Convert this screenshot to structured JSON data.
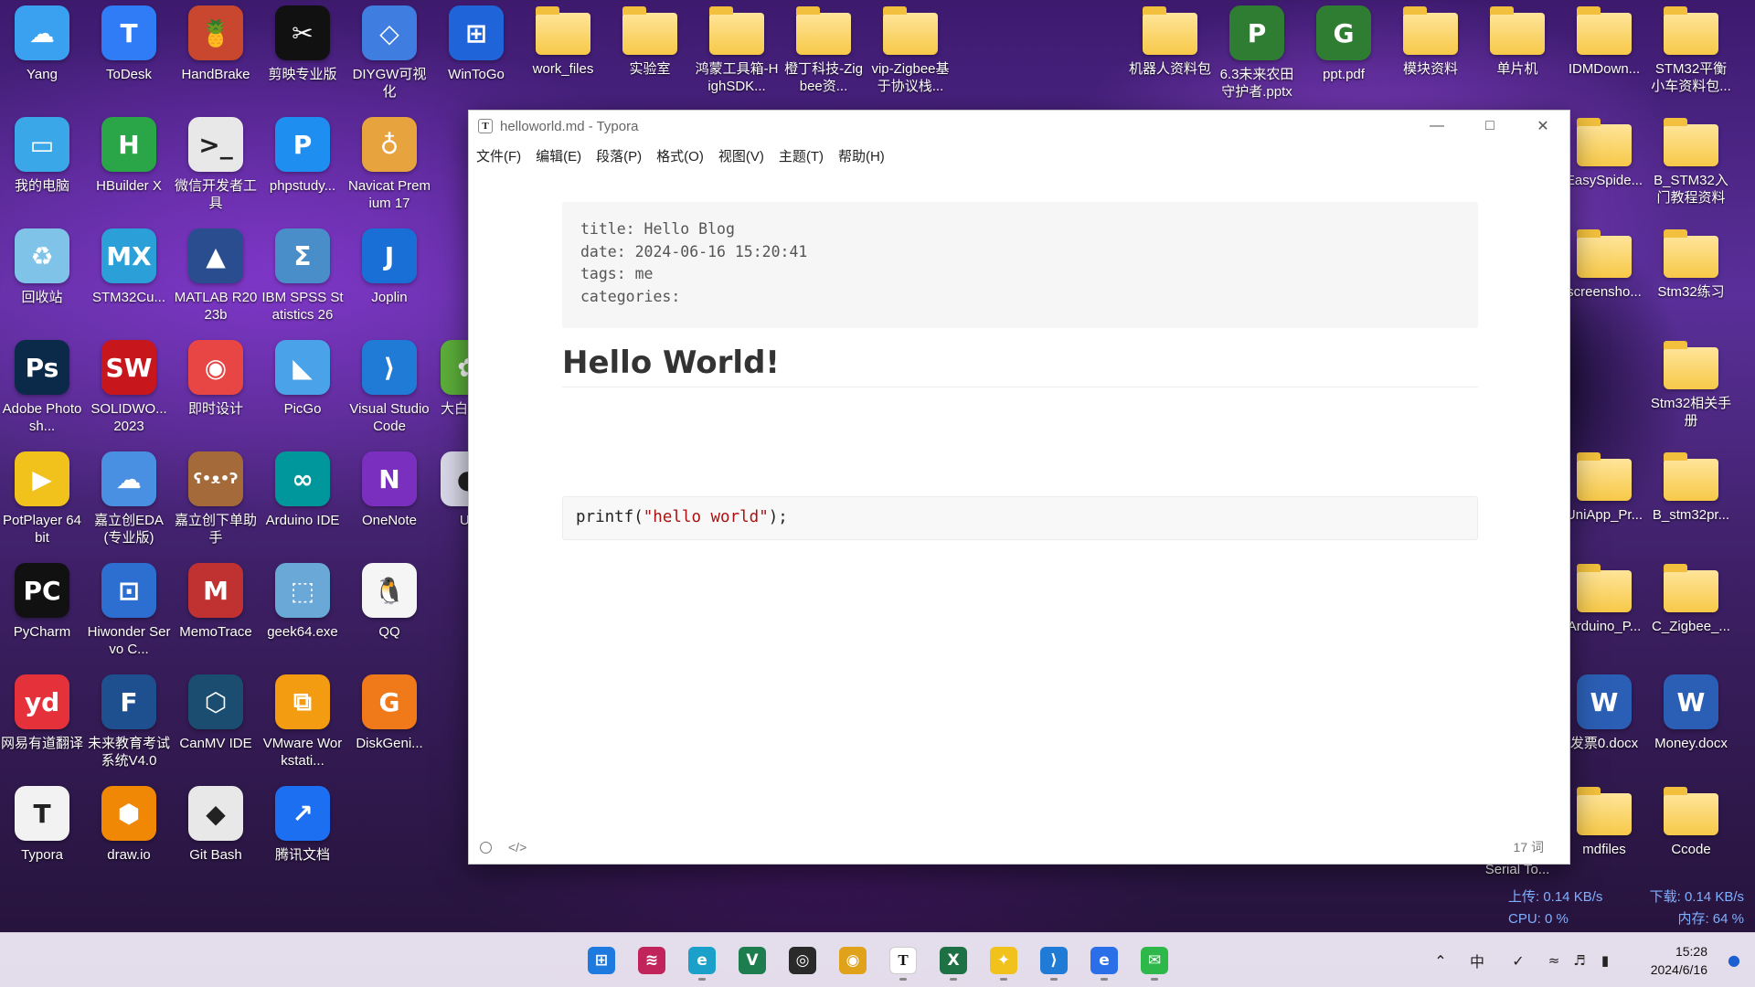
{
  "desktop_icons": [
    {
      "label": "Yang",
      "icon": "cloud-icon",
      "bg": "#3aa0f0"
    },
    {
      "label": "ToDesk",
      "icon": "todesk-icon",
      "bg": "#2f7cf6"
    },
    {
      "label": "HandBrake",
      "icon": "handbrake-icon",
      "bg": "#c9472f"
    },
    {
      "label": "剪映专业版",
      "icon": "capcut-icon",
      "bg": "#111111"
    },
    {
      "label": "DIYGW可视化",
      "icon": "diygw-icon",
      "bg": "#3f7de0"
    },
    {
      "label": "WinToGo",
      "icon": "wintogo-icon",
      "bg": "#1f64d8"
    },
    {
      "label": "work_files",
      "icon": "folder-icon",
      "bg": "folder"
    },
    {
      "label": "实验室",
      "icon": "folder-icon",
      "bg": "folder"
    },
    {
      "label": "鸿蒙工具箱-HighSDK...",
      "icon": "folder-icon",
      "bg": "folder"
    },
    {
      "label": "橙丁科技-Zigbee资...",
      "icon": "folder-icon",
      "bg": "folder"
    },
    {
      "label": "vip-Zigbee基于协议栈...",
      "icon": "folder-icon",
      "bg": "folder"
    },
    {
      "label": "机器人资料包",
      "icon": "folder-icon",
      "bg": "folder"
    },
    {
      "label": "6.3未来农田守护者.pptx",
      "icon": "pptx-icon",
      "bg": "#2e7d32"
    },
    {
      "label": "ppt.pdf",
      "icon": "pdf-icon",
      "bg": "#2e7d32"
    },
    {
      "label": "模块资料",
      "icon": "folder-icon",
      "bg": "folder"
    },
    {
      "label": "单片机",
      "icon": "folder-icon",
      "bg": "folder"
    },
    {
      "label": "IDMDown...",
      "icon": "folder-icon",
      "bg": "folder"
    },
    {
      "label": "STM32平衡小车资料包...",
      "icon": "folder-icon",
      "bg": "folder"
    },
    {
      "label": "我的电脑",
      "icon": "computer-icon",
      "bg": "#39a7e8"
    },
    {
      "label": "HBuilder X",
      "icon": "hbuilder-icon",
      "bg": "#2aa548"
    },
    {
      "label": "微信开发者工具",
      "icon": "wechat-devtools-icon",
      "bg": "#e8e8e8"
    },
    {
      "label": "phpstudy...",
      "icon": "phpstudy-icon",
      "bg": "#1f8ef1"
    },
    {
      "label": "Navicat Premium 17",
      "icon": "navicat-icon",
      "bg": "#e7a33d"
    },
    {
      "label": "EasySpide...",
      "icon": "folder-icon",
      "bg": "folder"
    },
    {
      "label": "B_STM32入门教程资料",
      "icon": "folder-icon",
      "bg": "folder"
    },
    {
      "label": "回收站",
      "icon": "recycle-bin-icon",
      "bg": "#7fc4e8"
    },
    {
      "label": "STM32Cu...",
      "icon": "stm32cube-icon",
      "bg": "#2a9fd8"
    },
    {
      "label": "MATLAB R2023b",
      "icon": "matlab-icon",
      "bg": "#2a4d8f"
    },
    {
      "label": "IBM SPSS Statistics 26",
      "icon": "spss-icon",
      "bg": "#4a8ec9"
    },
    {
      "label": "Joplin",
      "icon": "joplin-icon",
      "bg": "#1a6fd6"
    },
    {
      "label": "screensho...",
      "icon": "folder-icon",
      "bg": "folder"
    },
    {
      "label": "Stm32练习",
      "icon": "folder-icon",
      "bg": "folder"
    },
    {
      "label": "Adobe Photosh...",
      "icon": "photoshop-icon",
      "bg": "#0b2a4a"
    },
    {
      "label": "SOLIDWO... 2023",
      "icon": "solidworks-icon",
      "bg": "#c8161d"
    },
    {
      "label": "即时设计",
      "icon": "jsdesign-icon",
      "bg": "#e84545"
    },
    {
      "label": "PicGo",
      "icon": "picgo-icon",
      "bg": "#4aa3e8"
    },
    {
      "label": "Visual Studio Code",
      "icon": "vscode-icon",
      "bg": "#1f7bd6"
    },
    {
      "label": "大白菜装",
      "icon": "dabaicai-icon",
      "bg": "#5cae3a"
    },
    {
      "label": "Stm32相关手册",
      "icon": "folder-icon",
      "bg": "folder"
    },
    {
      "label": "PotPlayer 64 bit",
      "icon": "potplayer-icon",
      "bg": "#f1c21b"
    },
    {
      "label": "嘉立创EDA(专业版)",
      "icon": "jlc-eda-icon",
      "bg": "#4a90e2"
    },
    {
      "label": "嘉立创下单助手",
      "icon": "jlc-bear-icon",
      "bg": "#a56a3a"
    },
    {
      "label": "Arduino IDE",
      "icon": "arduino-icon",
      "bg": "#00979c"
    },
    {
      "label": "OneNote",
      "icon": "onenote-icon",
      "bg": "#7b2fbe"
    },
    {
      "label": "Ult",
      "icon": "ult-icon",
      "bg": "#d8d8e8"
    },
    {
      "label": "UniApp_Pr...",
      "icon": "folder-icon",
      "bg": "folder"
    },
    {
      "label": "B_stm32pr...",
      "icon": "folder-icon",
      "bg": "folder"
    },
    {
      "label": "PyCharm",
      "icon": "pycharm-icon",
      "bg": "#111111"
    },
    {
      "label": "Hiwonder Servo C...",
      "icon": "hiwonder-icon",
      "bg": "#2d6fd1"
    },
    {
      "label": "MemoTrace",
      "icon": "memotrace-icon",
      "bg": "#c03232"
    },
    {
      "label": "geek64.exe",
      "icon": "geek-icon",
      "bg": "#6aa8d8"
    },
    {
      "label": "QQ",
      "icon": "qq-icon",
      "bg": "#f5f5f5"
    },
    {
      "label": "Arduino_P...",
      "icon": "folder-icon",
      "bg": "folder"
    },
    {
      "label": "C_Zigbee_...",
      "icon": "folder-icon",
      "bg": "folder"
    },
    {
      "label": "网易有道翻译",
      "icon": "youdao-icon",
      "bg": "#e5323a"
    },
    {
      "label": "未来教育考试系统V4.0",
      "icon": "future-edu-icon",
      "bg": "#1e4f8f"
    },
    {
      "label": "CanMV IDE",
      "icon": "canmv-icon",
      "bg": "#1a4d6f"
    },
    {
      "label": "VMware Workstati...",
      "icon": "vmware-icon",
      "bg": "#f39c12"
    },
    {
      "label": "DiskGeni...",
      "icon": "diskgenius-icon",
      "bg": "#f07a1a"
    },
    {
      "label": "发票0.docx",
      "icon": "docx-icon",
      "bg": "#2b5fb5"
    },
    {
      "label": "Money.docx",
      "icon": "docx-icon",
      "bg": "#2b5fb5"
    },
    {
      "label": "Typora",
      "icon": "typora-icon",
      "bg": "#f2f2f2"
    },
    {
      "label": "draw.io",
      "icon": "drawio-icon",
      "bg": "#f08705"
    },
    {
      "label": "Git Bash",
      "icon": "git-icon",
      "bg": "#e8e8e8"
    },
    {
      "label": "腾讯文档",
      "icon": "tencent-docs-icon",
      "bg": "#1d6ff2"
    },
    {
      "label": "mdfiles",
      "icon": "folder-icon",
      "bg": "folder"
    },
    {
      "label": "Ccode",
      "icon": "folder-icon",
      "bg": "folder"
    },
    {
      "label": "Serial To...",
      "icon": "serial-icon",
      "bg": "none"
    }
  ],
  "window": {
    "title": "helloworld.md - Typora",
    "app_icon_letter": "T",
    "menu": [
      "文件(F)",
      "编辑(E)",
      "段落(P)",
      "格式(O)",
      "视图(V)",
      "主题(T)",
      "帮助(H)"
    ],
    "front_matter": [
      "title: Hello Blog",
      "date: 2024-06-16 15:20:41",
      "tags: me",
      "categories:"
    ],
    "heading": "Hello World!",
    "code": {
      "before": "printf(",
      "string": "\"hello world\"",
      "after": ");"
    },
    "word_count": "17 词"
  },
  "netmon": {
    "upload": "上传: 0.14 KB/s",
    "download": "下载: 0.14 KB/s",
    "cpu": "CPU: 0 %",
    "memory": "内存: 64 %"
  },
  "taskbar": {
    "apps": [
      "start-icon",
      "fdm-icon",
      "edge-icon",
      "vs-icon",
      "obs-icon",
      "chrome-icon",
      "typora-icon",
      "excel-icon",
      "photos-icon",
      "vscode-icon",
      "browser-icon",
      "wechat-icon"
    ],
    "time": "15:28",
    "date": "2024/6/16"
  }
}
